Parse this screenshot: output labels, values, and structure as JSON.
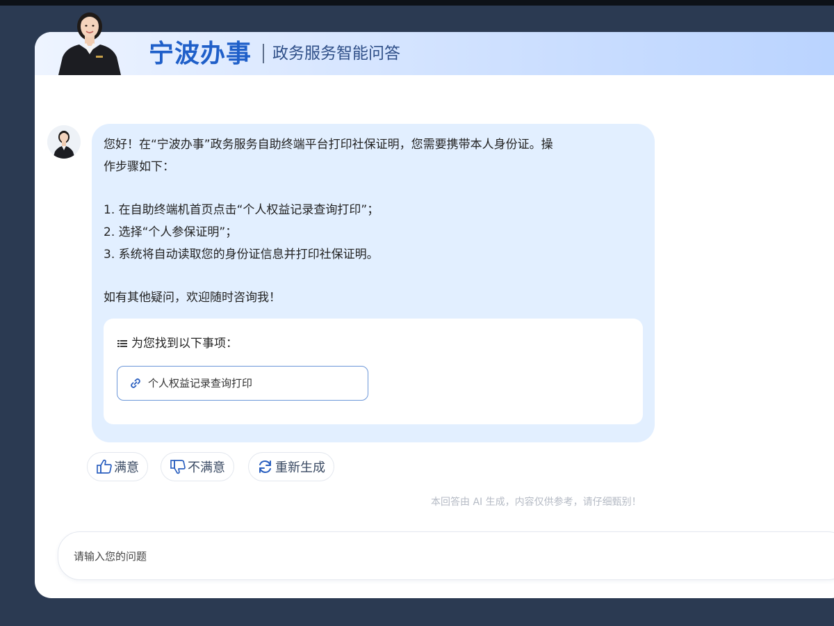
{
  "header": {
    "brand": "宁波办事",
    "subtitle": "政务服务智能问答"
  },
  "message": {
    "lines": [
      "您好！在“宁波办事”政务服务自助终端平台打印社保证明，您需要携带本人身份证。操",
      "作步骤如下：",
      "1. 在自助终端机首页点击“个人权益记录查询打印”；",
      "2. 选择“个人参保证明”；",
      "3. 系统将自动读取您的身份证信息并打印社保证明。",
      "如有其他疑问，欢迎随时咨询我！"
    ],
    "results_title": "为您找到以下事项：",
    "result_link": "个人权益记录查询打印"
  },
  "feedback": {
    "satisfied": "满意",
    "unsatisfied": "不满意",
    "regenerate": "重新生成"
  },
  "disclaimer": "本回答由 AI 生成，内容仅供参考，请仔细甄别！",
  "input": {
    "placeholder": "请输入您的问题"
  },
  "colors": {
    "brand": "#1f5fc9",
    "bubble": "#e2efff",
    "background": "#2b3a52",
    "link_border": "#6b96d8"
  }
}
